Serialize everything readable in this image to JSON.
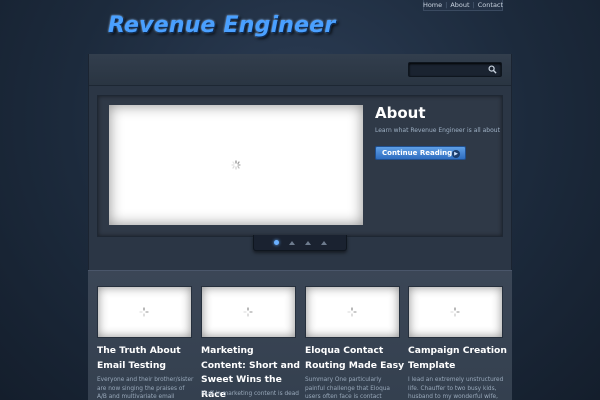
{
  "header": {
    "logo_text": "Revenue Engineer",
    "nav": [
      {
        "label": "Home"
      },
      {
        "label": "About"
      },
      {
        "label": "Contact"
      }
    ]
  },
  "search": {
    "placeholder": "",
    "icon": "search-icon"
  },
  "slider": {
    "title": "About",
    "subtitle": "Learn what Revenue Engineer is all about",
    "button_label": "Continue Reading",
    "button_icon": "arrow-right-icon",
    "pager": {
      "count": 4,
      "active": 1
    }
  },
  "posts": [
    {
      "title": "The Truth About Email Testing",
      "excerpt": "Everyone and their brother/sister are now singing the praises of A/B and multivariate email"
    },
    {
      "title": "Marketing Content: Short and Sweet Wins the Race",
      "excerpt": "Fluff in marketing content is dead"
    },
    {
      "title": "Eloqua Contact Routing Made Easy",
      "excerpt": "Summary One particularly painful challenge that Eloqua users often face is contact routing between"
    },
    {
      "title": "Campaign Creation Template",
      "excerpt": "I lead an extremely unstructured life. Chauffer to two busy kids, husband to my wonderful wife,"
    }
  ],
  "colors": {
    "background": "#1c2a3c",
    "accent": "#4aa0ff",
    "button": "#3f80d4"
  }
}
